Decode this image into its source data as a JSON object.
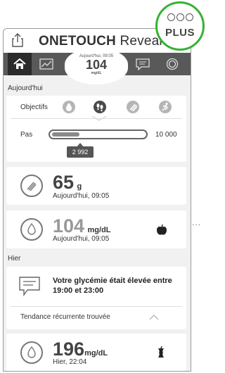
{
  "plus_badge": {
    "label": "PLUS"
  },
  "header": {
    "brand_prefix": "ONETOUCH",
    "brand_suffix": " Reveal",
    "reg": "®"
  },
  "latest_reading": {
    "time": "Aujourd'hui, 09:05",
    "value": "104",
    "unit": "mg/dL"
  },
  "tabs": [
    {
      "name": "home",
      "icon": "home-icon"
    },
    {
      "name": "chart",
      "icon": "chart-icon"
    },
    {
      "name": "messages",
      "icon": "message-icon"
    },
    {
      "name": "settings",
      "icon": "ring-icon"
    }
  ],
  "today": {
    "section_label": "Aujourd'hui",
    "objectives_label": "Objectifs",
    "objective_icons": [
      "drop-icon",
      "footsteps-icon",
      "fork-icon",
      "runner-icon"
    ],
    "steps_label": "Pas",
    "steps_max": "10 000",
    "steps_value": "2 992",
    "steps_fraction": 0.3
  },
  "carbs_card": {
    "value": "65",
    "unit": "g",
    "time": "Aujourd'hui, 09:05",
    "icon": "fork-icon"
  },
  "glucose_card_today": {
    "value": "104",
    "unit": "mg/dL",
    "time": "Aujourd'hui, 09:05",
    "tag_icon": "apple-icon"
  },
  "yesterday": {
    "section_label": "Hier",
    "message": "Votre glycémie était élevée entre 19:00 et 23:00",
    "trend_label": "Tendance récurrente trouvée",
    "reading": {
      "value": "196",
      "unit": "mg/dL",
      "time": "Hier, 22:04",
      "tag_icon": "apple-core-icon"
    }
  }
}
